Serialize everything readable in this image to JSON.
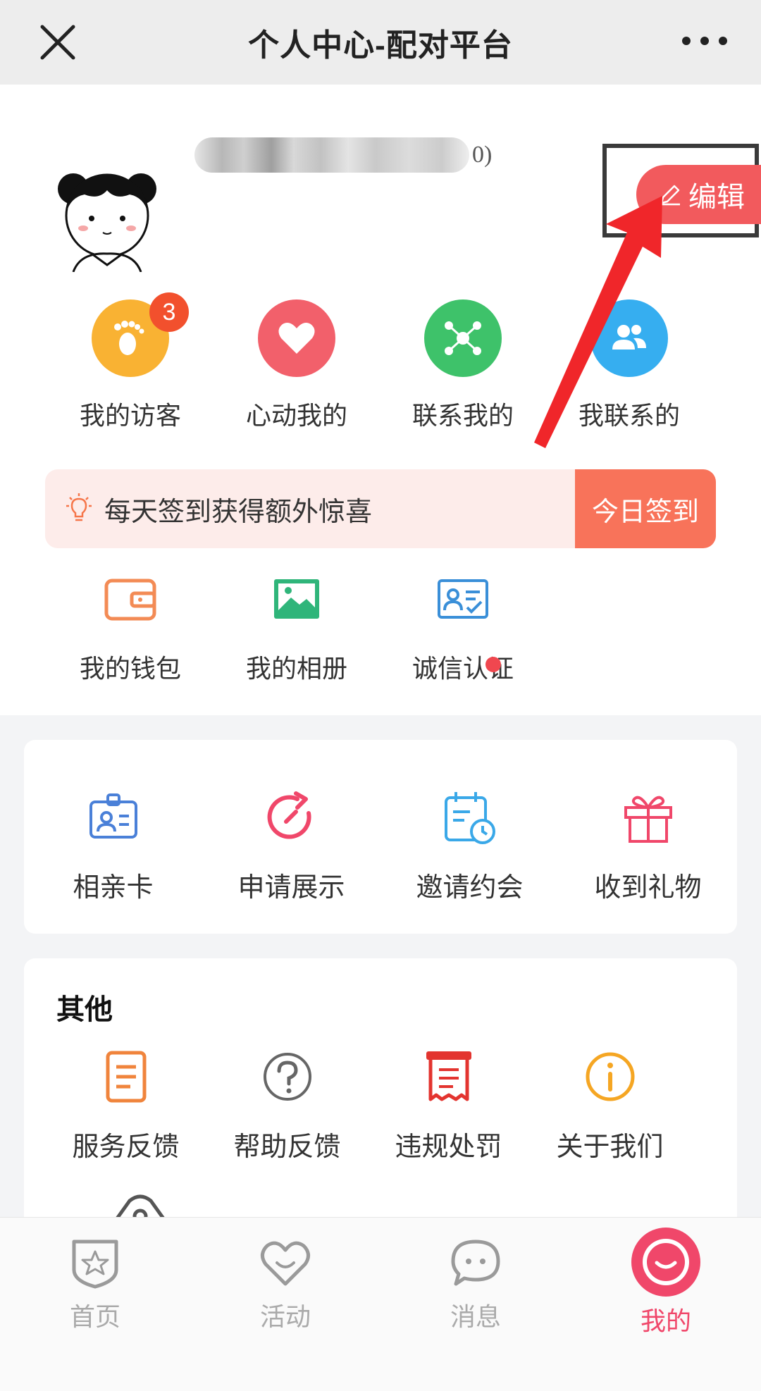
{
  "titlebar": {
    "title": "个人中心-配对平台",
    "close_icon": "close-icon",
    "more_icon": "more-icon"
  },
  "profile": {
    "username_suffix": "0)",
    "edit_label": "编辑"
  },
  "quick_actions": [
    {
      "label": "我的访客",
      "icon": "footprint-icon",
      "color": "#f9b233",
      "badge": "3"
    },
    {
      "label": "心动我的",
      "icon": "heart-icon",
      "color": "#f2606b"
    },
    {
      "label": "联系我的",
      "icon": "network-icon",
      "color": "#3ec26a"
    },
    {
      "label": "我联系的",
      "icon": "users-icon",
      "color": "#36aef0"
    }
  ],
  "signin": {
    "text": "每天签到获得额外惊喜",
    "button": "今日签到"
  },
  "tools": [
    {
      "label": "我的钱包",
      "icon": "wallet-icon"
    },
    {
      "label": "我的相册",
      "icon": "album-icon"
    },
    {
      "label": "诚信认证",
      "icon": "id-verify-icon"
    }
  ],
  "features": [
    {
      "label": "相亲卡",
      "icon": "badge-card-icon"
    },
    {
      "label": "申请展示",
      "icon": "refresh-arrow-icon"
    },
    {
      "label": "邀请约会",
      "icon": "calendar-clock-icon"
    },
    {
      "label": "收到礼物",
      "icon": "gift-icon"
    }
  ],
  "others": {
    "title": "其他",
    "items": [
      {
        "label": "服务反馈",
        "icon": "document-icon"
      },
      {
        "label": "帮助反馈",
        "icon": "question-icon"
      },
      {
        "label": "违规处罚",
        "icon": "receipt-icon"
      },
      {
        "label": "关于我们",
        "icon": "info-icon"
      }
    ]
  },
  "tabbar": [
    {
      "label": "首页",
      "icon": "home-shield-star-icon"
    },
    {
      "label": "活动",
      "icon": "heart-smile-icon"
    },
    {
      "label": "消息",
      "icon": "chat-bubble-icon"
    },
    {
      "label": "我的",
      "icon": "smile-face-icon",
      "active": true
    }
  ],
  "colors": {
    "accent": "#f25a5d",
    "signin_button": "#f8735a",
    "active_tab": "#f0476a",
    "annotation_arrow": "#f0262a"
  }
}
